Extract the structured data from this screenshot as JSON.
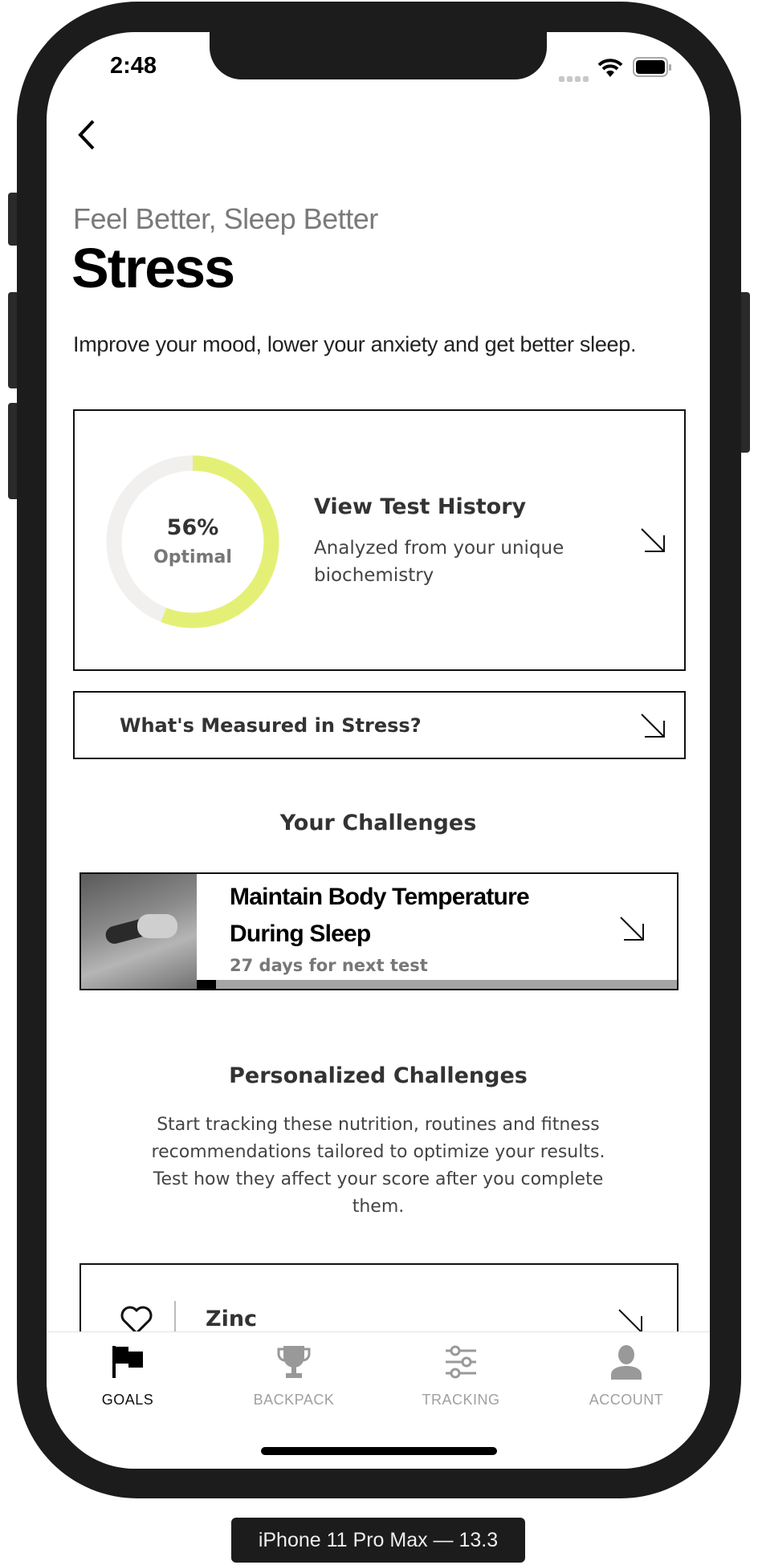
{
  "status_bar": {
    "time": "2:48"
  },
  "header": {
    "subtitle": "Feel Better, Sleep Better",
    "title": "Stress",
    "description": "Improve your mood, lower your anxiety and get better sleep."
  },
  "score_card": {
    "percent_label": "56%",
    "percent_value": 56,
    "status": "Optimal",
    "title": "View Test History",
    "desc_line1": "Analyzed from your unique",
    "desc_line2": "biochemistry",
    "ring_color": "#e4f075",
    "track_color": "#f1f0ef"
  },
  "measured_card": {
    "label": "What's Measured in Stress?"
  },
  "your_challenges": {
    "heading": "Your Challenges",
    "items": [
      {
        "title_line1": "Maintain Body Temperature",
        "title_line2": "During Sleep",
        "subtitle": "27 days for next test",
        "progress": 0.04
      }
    ]
  },
  "personalized": {
    "heading": "Personalized Challenges",
    "lines": [
      "Start tracking these nutrition, routines and fitness",
      "recommendations tailored to optimize your results.",
      "Test how they affect your score after you complete",
      "them."
    ],
    "items": [
      {
        "name": "Zinc",
        "icon": "heart-icon"
      }
    ]
  },
  "tabs": [
    {
      "label": "GOALS",
      "icon": "flag-icon",
      "active": true
    },
    {
      "label": "BACKPACK",
      "icon": "trophy-icon",
      "active": false
    },
    {
      "label": "TRACKING",
      "icon": "sliders-icon",
      "active": false
    },
    {
      "label": "ACCOUNT",
      "icon": "user-icon",
      "active": false
    }
  ],
  "device_label": "iPhone 11 Pro Max — 13.3"
}
